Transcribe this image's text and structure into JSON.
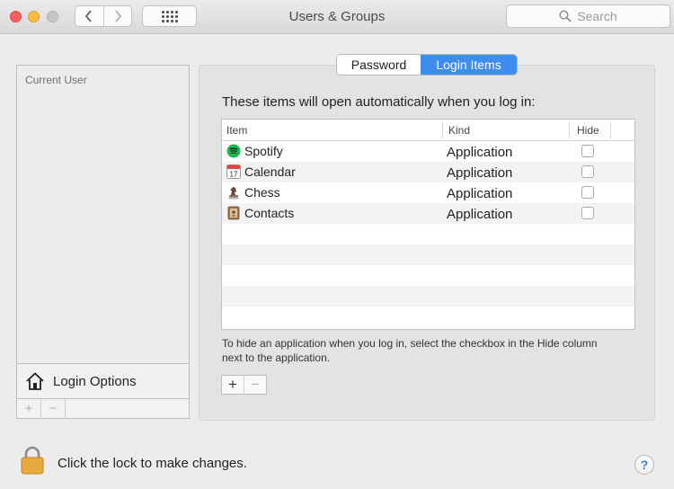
{
  "window": {
    "title": "Users & Groups",
    "nav_back_icon": "chevron-left-icon",
    "nav_forward_icon": "chevron-right-icon",
    "show_all_icon": "grid-icon"
  },
  "search": {
    "placeholder": "Search",
    "icon": "magnifier-icon"
  },
  "sidebar": {
    "section_label": "Current User",
    "login_options_label": "Login Options",
    "add_label": "+",
    "remove_label": "−"
  },
  "tabs": [
    {
      "label": "Password",
      "selected": false
    },
    {
      "label": "Login Items",
      "selected": true
    }
  ],
  "login_items": {
    "intro": "These items will open automatically when you log in:",
    "columns": {
      "item": "Item",
      "kind": "Kind",
      "hide": "Hide"
    },
    "rows": [
      {
        "name": "Spotify",
        "kind": "Application",
        "hide": false,
        "icon": "spotify-icon"
      },
      {
        "name": "Calendar",
        "kind": "Application",
        "hide": false,
        "icon": "calendar-icon"
      },
      {
        "name": "Chess",
        "kind": "Application",
        "hide": false,
        "icon": "chess-icon"
      },
      {
        "name": "Contacts",
        "kind": "Application",
        "hide": false,
        "icon": "contacts-icon"
      }
    ],
    "hint": "To hide an application when you log in, select the checkbox in the Hide column next to the application.",
    "add_label": "+",
    "remove_label": "−"
  },
  "footer": {
    "lock_text": "Click the lock to make changes.",
    "help_label": "?"
  },
  "colors": {
    "selected_tab": "#3e8cf0",
    "close": "#fc605c",
    "minimize": "#fdbc40",
    "lock": "#e8a93e"
  }
}
